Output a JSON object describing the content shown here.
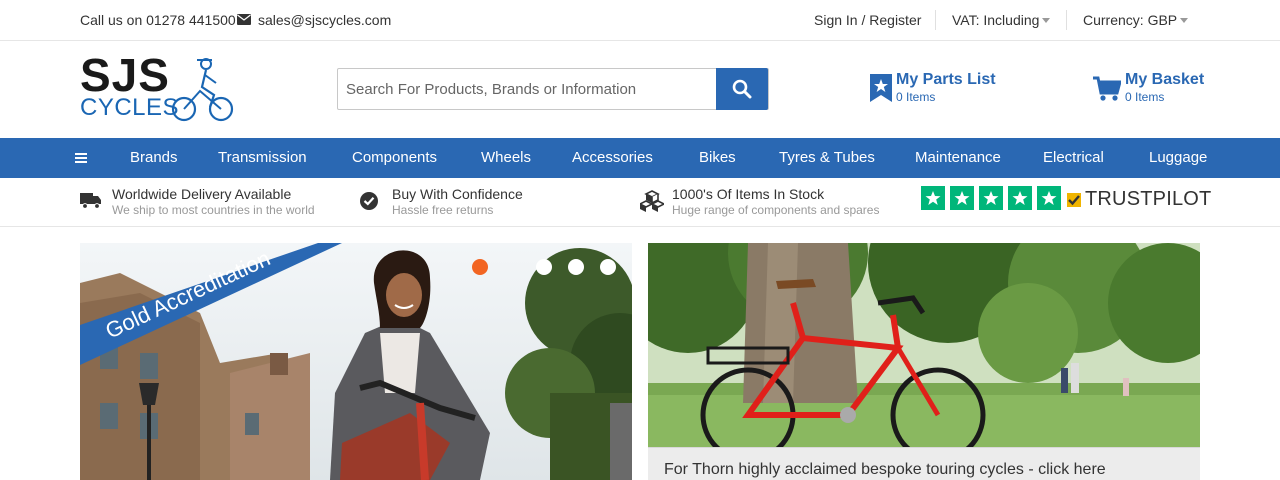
{
  "topbar": {
    "phone": "Call us on 01278 441500",
    "email": "sales@sjscycles.com",
    "sign_in": "Sign In / Register",
    "vat": "VAT: Including",
    "currency": "Currency: GBP"
  },
  "logo": {
    "line1": "SJS",
    "line2": "CYCLES"
  },
  "search": {
    "placeholder": "Search For Products, Brands or Information",
    "value": ""
  },
  "parts_list": {
    "title": "My Parts List",
    "count": "0 Items"
  },
  "basket": {
    "title": "My Basket",
    "count": "0 Items"
  },
  "nav": {
    "items": [
      "Brands",
      "Transmission",
      "Components",
      "Wheels",
      "Accessories",
      "Bikes",
      "Tyres & Tubes",
      "Maintenance",
      "Electrical",
      "Luggage"
    ]
  },
  "usp": [
    {
      "title": "Worldwide Delivery Available",
      "sub": "We ship to most countries in the world",
      "icon": "truck-icon"
    },
    {
      "title": "Buy With Confidence",
      "sub": "Hassle free returns",
      "icon": "check-circle-icon"
    },
    {
      "title": "1000's Of Items In Stock",
      "sub": "Huge range of components and spares",
      "icon": "boxes-icon"
    }
  ],
  "trustpilot": {
    "word": "TRUSTPILOT",
    "stars": 5
  },
  "banners": {
    "left": {
      "ribbon": "Gold Accreditation",
      "active_slide": 1,
      "slide_count": 5
    },
    "right": {
      "caption": "For Thorn highly acclaimed bespoke touring cycles - click here"
    }
  },
  "colors": {
    "brand_blue": "#2a68b3",
    "trustpilot_green": "#00b67a",
    "slider_active": "#f26522"
  }
}
